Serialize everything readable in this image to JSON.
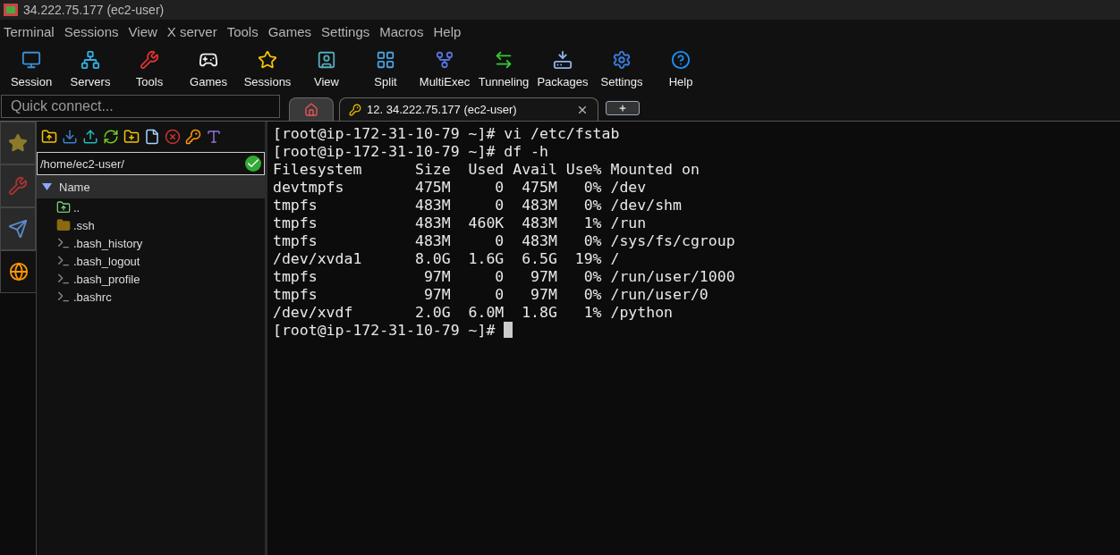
{
  "window": {
    "title": "34.222.75.177 (ec2-user)"
  },
  "menu": [
    "Terminal",
    "Sessions",
    "View",
    "X server",
    "Tools",
    "Games",
    "Settings",
    "Macros",
    "Help"
  ],
  "toolbar": [
    "Session",
    "Servers",
    "Tools",
    "Games",
    "Sessions",
    "View",
    "Split",
    "MultiExec",
    "Tunneling",
    "Packages",
    "Settings",
    "Help"
  ],
  "quick_connect": {
    "placeholder": "Quick connect..."
  },
  "tabs": [
    {
      "kind": "home",
      "selected": false
    },
    {
      "kind": "session",
      "label": "12. 34.222.75.177 (ec2-user)",
      "selected": true
    }
  ],
  "side_tabs": [
    {
      "selected": false
    },
    {
      "selected": false
    },
    {
      "selected": false
    },
    {
      "selected": true
    }
  ],
  "file_browser": {
    "path": "/home/ec2-user/",
    "column": "Name",
    "files": [
      {
        "name": "..",
        "kind": "parent"
      },
      {
        "name": ".ssh",
        "kind": "folder"
      },
      {
        "name": ".bash_history",
        "kind": "file"
      },
      {
        "name": ".bash_logout",
        "kind": "file"
      },
      {
        "name": ".bash_profile",
        "kind": "file"
      },
      {
        "name": ".bashrc",
        "kind": "file"
      }
    ]
  },
  "terminal": {
    "lines": [
      "[root@ip-172-31-10-79 ~]# vi /etc/fstab",
      "[root@ip-172-31-10-79 ~]# df -h",
      "Filesystem      Size  Used Avail Use% Mounted on",
      "devtmpfs        475M     0  475M   0% /dev",
      "tmpfs           483M     0  483M   0% /dev/shm",
      "tmpfs           483M  460K  483M   1% /run",
      "tmpfs           483M     0  483M   0% /sys/fs/cgroup",
      "/dev/xvda1      8.0G  1.6G  6.5G  19% /",
      "tmpfs            97M     0   97M   0% /run/user/1000",
      "tmpfs            97M     0   97M   0% /run/user/0",
      "/dev/xvdf       2.0G  6.0M  1.8G   1% /python"
    ],
    "prompt": "[root@ip-172-31-10-79 ~]# ",
    "cursor": true
  }
}
